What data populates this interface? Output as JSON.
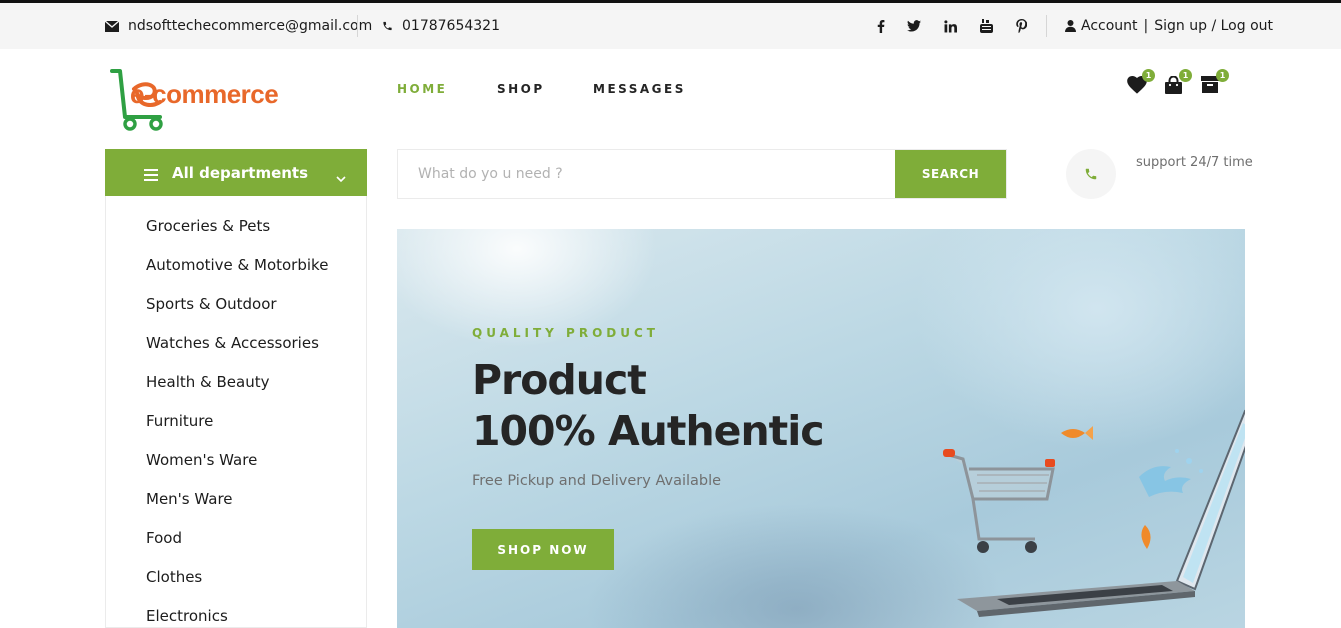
{
  "topbar": {
    "email": "ndsofttechecommerce@gmail.com",
    "phone": "01787654321",
    "social_icons": [
      "facebook-icon",
      "twitter-icon",
      "linkedin-icon",
      "youtube-icon",
      "pinterest-icon"
    ],
    "account_label": "Account",
    "auth_label": "Sign up / Log out"
  },
  "header": {
    "logo_text": "e-commerce",
    "nav": [
      {
        "label": "HOME",
        "active": true
      },
      {
        "label": "SHOP",
        "active": false
      },
      {
        "label": "MESSAGES",
        "active": false
      }
    ],
    "icons": [
      {
        "icon": "heart-icon",
        "count": "1"
      },
      {
        "icon": "shopping-bag-icon",
        "count": "1"
      },
      {
        "icon": "archive-box-icon",
        "count": "1"
      }
    ]
  },
  "departments": {
    "title": "All departments",
    "items": [
      "Groceries & Pets",
      "Automotive & Motorbike",
      "Sports & Outdoor",
      "Watches & Accessories",
      "Health & Beauty",
      "Furniture",
      "Women's Ware",
      "Men's Ware",
      "Food",
      "Clothes",
      "Electronics"
    ]
  },
  "search": {
    "placeholder": "What do yo u need ?",
    "button_label": "SEARCH"
  },
  "support": {
    "text": "support 24/7 time"
  },
  "hero": {
    "kicker": "QUALITY PRODUCT",
    "title_line1": "Product",
    "title_line2": "100% Authentic",
    "subtitle": "Free Pickup and Delivery Available",
    "cta_label": "SHOP NOW"
  },
  "colors": {
    "accent": "#7fad39",
    "logo_orange": "#e8682a",
    "logo_green": "#2fa043",
    "text_dark": "#1c1c1c",
    "muted": "#6f6f6f"
  }
}
